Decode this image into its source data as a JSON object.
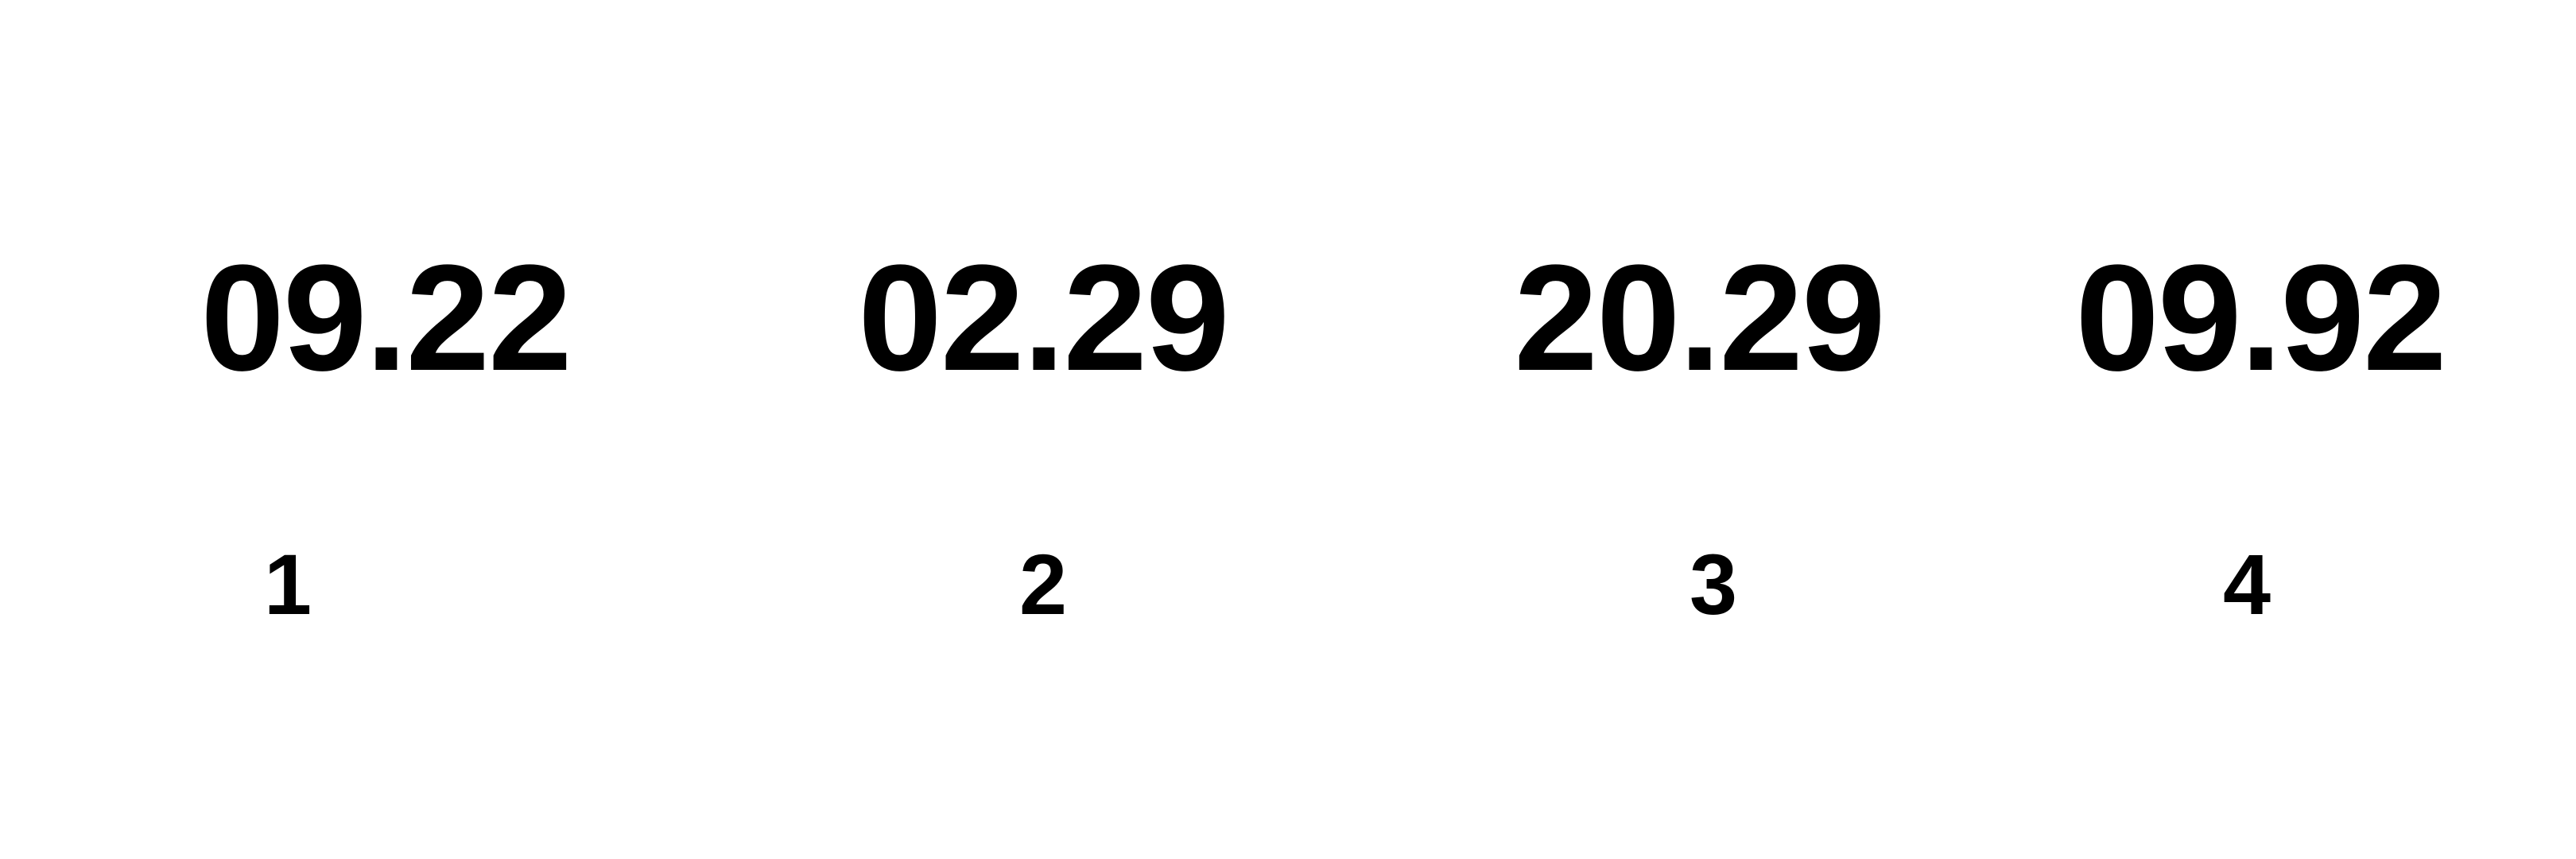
{
  "options": [
    {
      "value": "09.22",
      "label": "1"
    },
    {
      "value": "02.29",
      "label": "2"
    },
    {
      "value": "20.29",
      "label": "3"
    },
    {
      "value": "09.92",
      "label": "4"
    }
  ],
  "colors": {
    "background": "#ffffff",
    "text": "#000000"
  }
}
